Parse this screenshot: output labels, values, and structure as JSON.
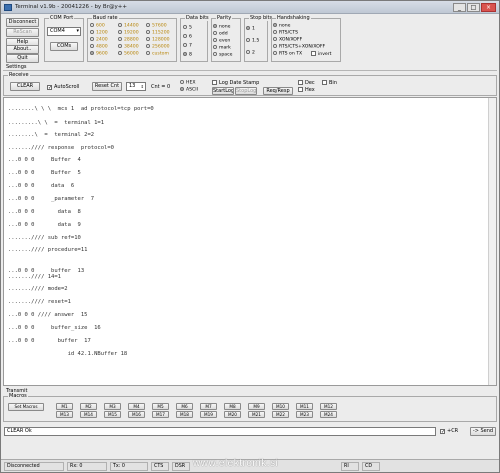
{
  "window": {
    "title": "Terminal v1.9b - 20041226 - by Br@y++"
  },
  "top_buttons": [
    "Disconnect",
    "ReScan",
    "Help",
    "About..",
    "Quit"
  ],
  "comport": {
    "label": "COM Port",
    "value": "COM4",
    "btn": "COMs"
  },
  "baud": {
    "label": "Baud rate",
    "options": [
      "600",
      "1200",
      "2400",
      "4800",
      "9600",
      "14400",
      "19200",
      "28800",
      "38400",
      "56000",
      "57600",
      "115200",
      "128000",
      "256000",
      "custom"
    ],
    "selected": "9600",
    "custom_value": "9600"
  },
  "databits": {
    "label": "Data bits",
    "options": [
      "5",
      "6",
      "7",
      "8"
    ],
    "selected": "8"
  },
  "parity": {
    "label": "Parity",
    "options": [
      "none",
      "odd",
      "even",
      "mark",
      "space"
    ],
    "selected": "none"
  },
  "stopbits": {
    "label": "Stop bits",
    "options": [
      "1",
      "1.5",
      "2"
    ],
    "selected": "1"
  },
  "handshaking": {
    "label": "Handshaking",
    "options": [
      "none",
      "RTS/CTS",
      "XON/XOFF",
      "RTS/CTS+XON/XOFF",
      "RTS on TX"
    ],
    "selected": "none",
    "invert_label": "invert"
  },
  "settings_label": "Settings",
  "receive": {
    "label": "Receive",
    "clear_btn": "CLEAR",
    "autoscroll": "AutoScroll",
    "reset_cnt": "Reset Cnt",
    "cnt_value": "13",
    "cnt_label": "Cnt = 0",
    "hex_label": "HEX",
    "ascii_label": "ASCII",
    "logdate": "Log Date Stamp",
    "startlog": "StartLog",
    "stoplog": "StopLog",
    "reqresp": "Req/Resp",
    "dec": "Dec",
    "hex2": "Hex",
    "bin": "Bin"
  },
  "terminal_lines": [
    "........\\ \\ \\  mcs 1  ad protocol=tcp port=0",
    ".........\\ \\  =  terminal 1=1",
    "........\\  =  terminal 2=2",
    ".......//// response  protocol=0",
    "...0 0 0     Buffer  4",
    "...0 0 0     Buffer  5",
    "...0 0 0     data  6",
    "...0 0 0     _parameter  7",
    "...0 0 0       data  8",
    "...0 0 0       data  9",
    ".......//// sub ref=10",
    ".......//// procedure=11",
    "...0 0 0     buffer  13",
    ".......//// 14=1",
    ".......//// mode=2",
    ".......//// reset=1",
    "...0 0 0 //// answer  15",
    "...0 0 0     buffer_size  16",
    "...0 0 0       buffer  17",
    "                  id 42.1.NBuffer 18"
  ],
  "transmit_label": "Transmit",
  "macros_label": "Macros",
  "set_macros": "Set Macros",
  "macro_row1": [
    "M1",
    "M2",
    "M3",
    "M4",
    "M5",
    "M6",
    "M7",
    "M8",
    "M9",
    "M10",
    "M11",
    "M12"
  ],
  "macro_row2": [
    "M13",
    "M14",
    "M15",
    "M16",
    "M17",
    "M18",
    "M19",
    "M20",
    "M21",
    "M22",
    "M23",
    "M24"
  ],
  "send_field": "CLEAR Ok",
  "send_options": {
    "cr": "+CR",
    "send": "-> Send"
  },
  "status": {
    "port": "Disconnected",
    "rx": "Rx: 0",
    "tx": "Tx: 0",
    "led1": "CTS",
    "led2": "DSR",
    "led3": "RI",
    "led4": "CD"
  },
  "watermark": "www.elektronik.si"
}
